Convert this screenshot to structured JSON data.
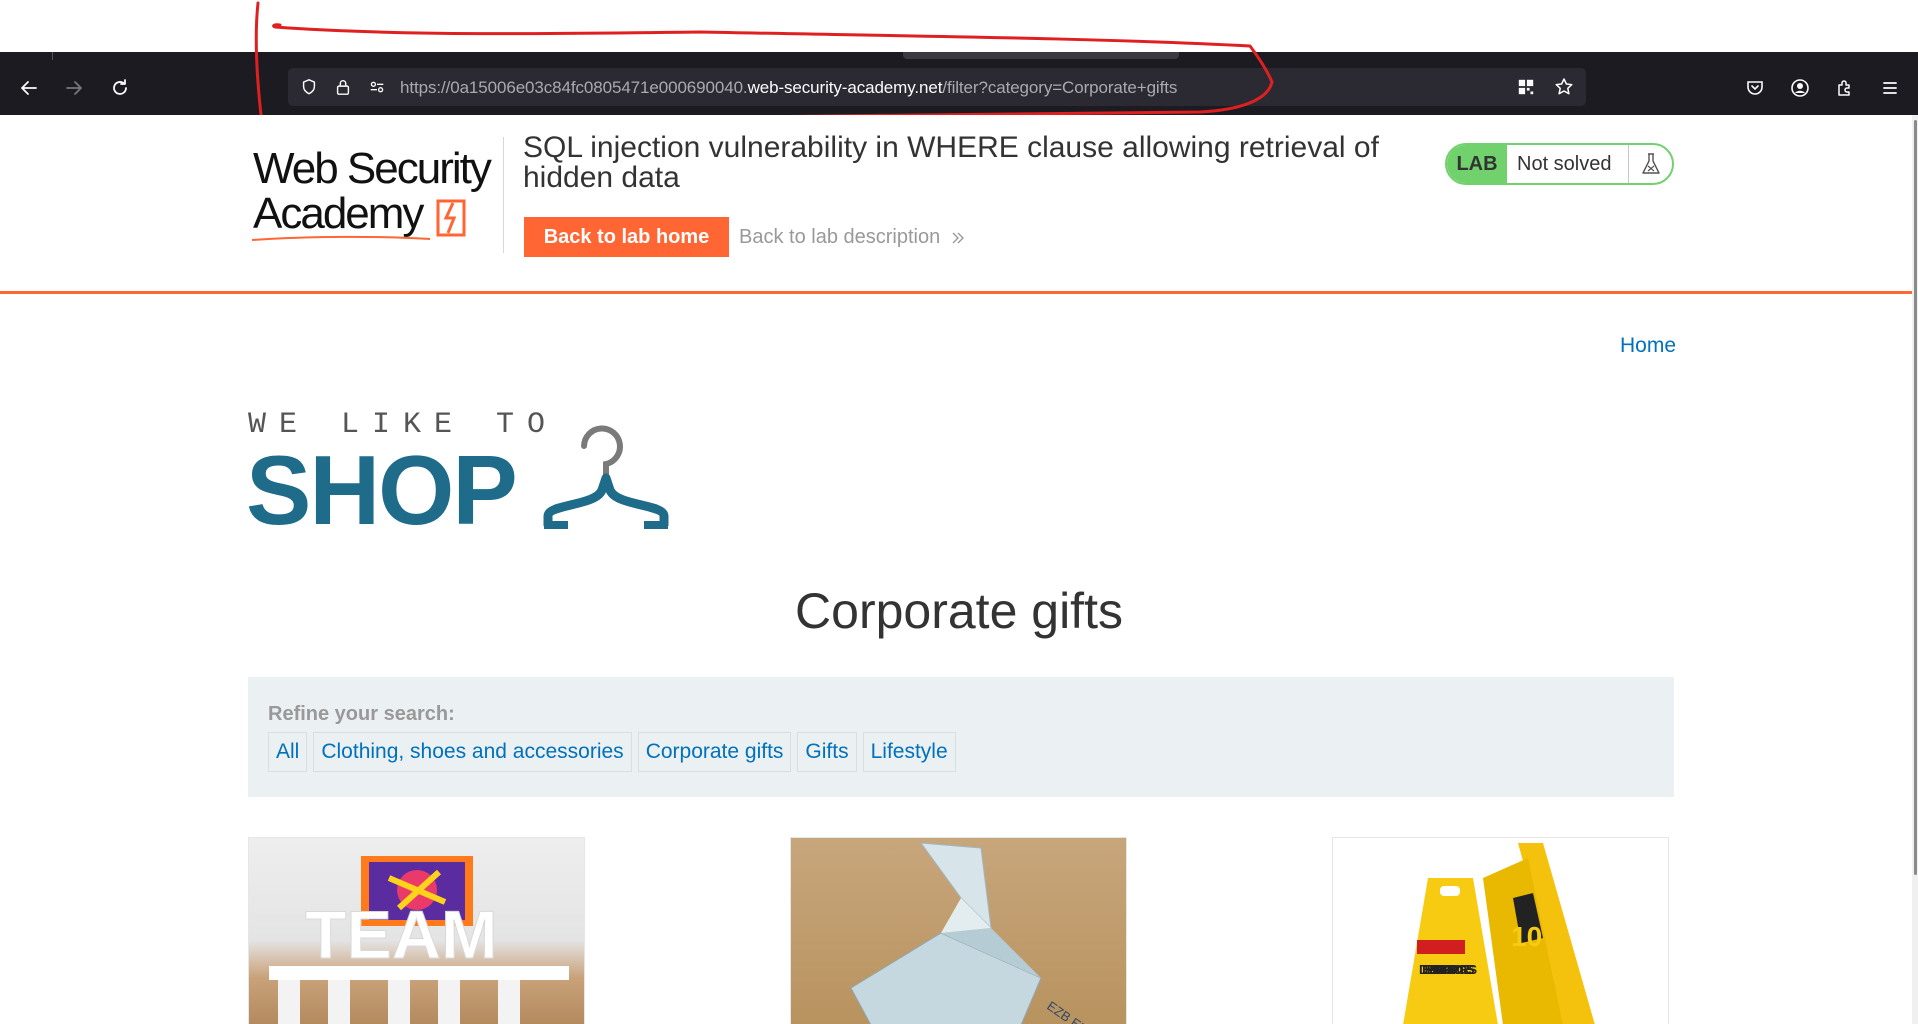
{
  "browser": {
    "url_prefix": "https://0a15006e03c84fc0805471e000690040.",
    "url_domain": "web-security-academy.net",
    "url_path": "/filter?category=Corporate+gifts",
    "icons": [
      "back-icon",
      "forward-icon",
      "reload-icon",
      "shield-icon",
      "lock-icon",
      "permissions-icon",
      "qr-code-icon",
      "bookmark-star-icon",
      "pocket-icon",
      "account-icon",
      "extensions-icon",
      "menu-icon"
    ]
  },
  "lab": {
    "logo_line1": "Web Security",
    "logo_line2": "Academy",
    "title": "SQL injection vulnerability in WHERE clause allowing retrieval of hidden data",
    "home_button": "Back to lab home",
    "description_link": "Back to lab description",
    "status_pill": "LAB",
    "status_text": "Not solved",
    "colors": {
      "accent": "#ff6633",
      "status": "#70d16d"
    }
  },
  "shop": {
    "home_link": "Home",
    "tagline": "WE LIKE TO",
    "word": "SHOP",
    "heading": "Corporate gifts",
    "refine_label": "Refine your search:",
    "filters": [
      "All",
      "Clothing, shoes and accessories",
      "Corporate gifts",
      "Gifts",
      "Lifestyle"
    ],
    "colors": {
      "link": "#0071bc",
      "brand": "#1e6b8a",
      "panel": "#ebf0f2"
    },
    "products": [
      {
        "image_text": "TEAM"
      },
      {
        "image_text": ""
      },
      {
        "image_text": "DEEPLY SATISFYING POO IN PROGRESS"
      }
    ]
  }
}
